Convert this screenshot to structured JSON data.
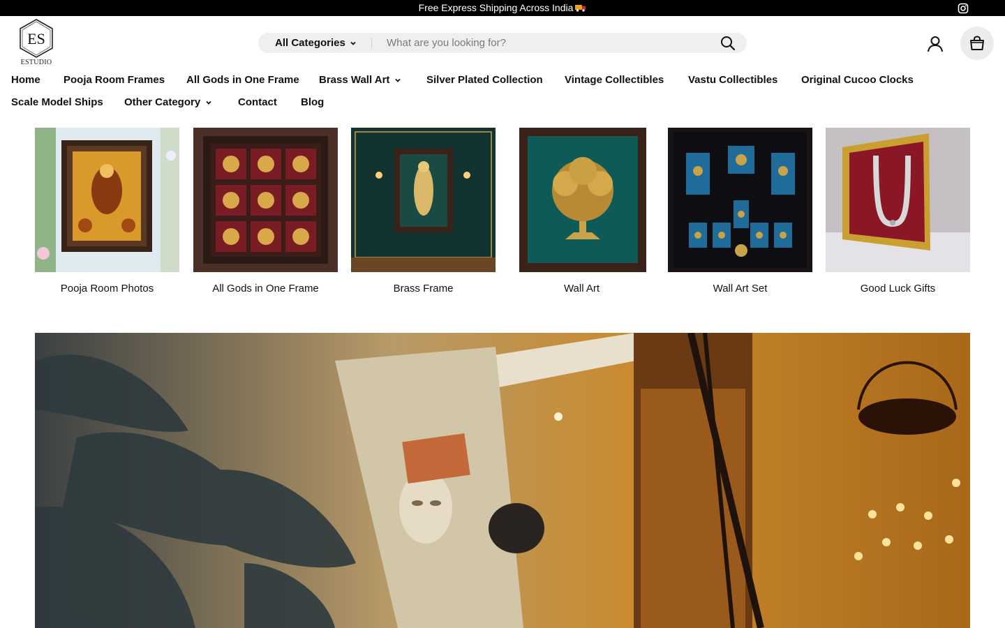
{
  "announcement": {
    "text": "Free Express Shipping Across India",
    "icon": "truck-icon"
  },
  "social": {
    "instagram": "instagram-icon"
  },
  "logo": {
    "monogram": "ES",
    "wordmark": "ESTUDIO"
  },
  "search": {
    "category_label": "All Categories",
    "placeholder": "What are you looking for?",
    "value": ""
  },
  "header_icons": {
    "account": "user-icon",
    "cart": "shopping-bag-icon"
  },
  "nav": {
    "row1": [
      {
        "label": "Home"
      },
      {
        "label": "Pooja Room Frames"
      },
      {
        "label": "All Gods in One Frame"
      },
      {
        "label": "Brass Wall Art",
        "dropdown": true
      },
      {
        "label": "Silver Plated Collection"
      },
      {
        "label": "Vintage Collectibles"
      },
      {
        "label": "Vastu Collectibles"
      },
      {
        "label": "Original Cucoo Clocks"
      }
    ],
    "row2": [
      {
        "label": "Scale Model Ships"
      },
      {
        "label": "Other Category",
        "dropdown": true
      },
      {
        "label": "Contact"
      },
      {
        "label": "Blog"
      }
    ]
  },
  "collections": [
    {
      "label": "Pooja Room Photos"
    },
    {
      "label": "All Gods in One Frame"
    },
    {
      "label": "Brass Frame"
    },
    {
      "label": "Wall Art"
    },
    {
      "label": "Wall Art Set"
    },
    {
      "label": "Good Luck Gifts"
    }
  ],
  "colors": {
    "announcement_bg": "#000000",
    "search_bg": "#efefef",
    "cart_bg": "#ececec"
  }
}
